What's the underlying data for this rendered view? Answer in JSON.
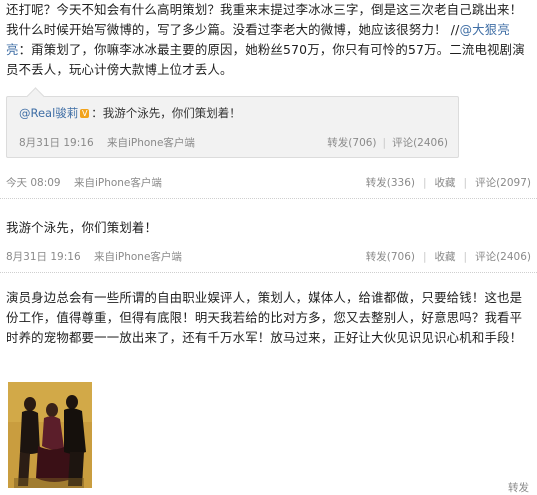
{
  "post_top": {
    "text_parts": [
      "还打呢？今天不知会有什么高明策划？我重来末提过李冰冰三字，倒是这三次老自己跳出来！我什么时候开始写微博的，写了多少篇。没看过李老大的微博，她应该很努力！ //",
      "@大狠亮亮",
      "：甭策划了，你嘛李冰冰最主要的原因，她粉丝570万，你只有可怜的57万。二流电视剧演员不丢人，玩心计傍大款博上位才丢人。"
    ]
  },
  "quote": {
    "author": "@Real骏莉",
    "badge": "V",
    "text": "：我游个泳先，你们策划着！",
    "time": "8月31日 19:16",
    "source": "来自iPhone客户端",
    "repost": "转发(706)",
    "comment": "评论(2406)"
  },
  "post_top_meta": {
    "time": "今天 08:09",
    "source": "来自iPhone客户端",
    "repost": "转发(336)",
    "favorite": "收藏",
    "comment": "评论(2097)"
  },
  "post_mid": {
    "text": "我游个泳先，你们策划着！",
    "time": "8月31日 19:16",
    "source": "来自iPhone客户端",
    "repost": "转发(706)",
    "favorite": "收藏",
    "comment": "评论(2406)"
  },
  "post_bottom": {
    "text": "演员身边总会有一些所谓的自由职业娱评人，策划人，媒体人，给谁都做，只要给钱！这也是份工作，值得尊重，但得有底限！明天我若给的比对方多，您又去整别人，好意思吗？我看平时养的宠物都要一一放出来了，还有千万水军！放马过来，正好让大伙见识见识心机和手段！",
    "bottom_right": "转发"
  }
}
